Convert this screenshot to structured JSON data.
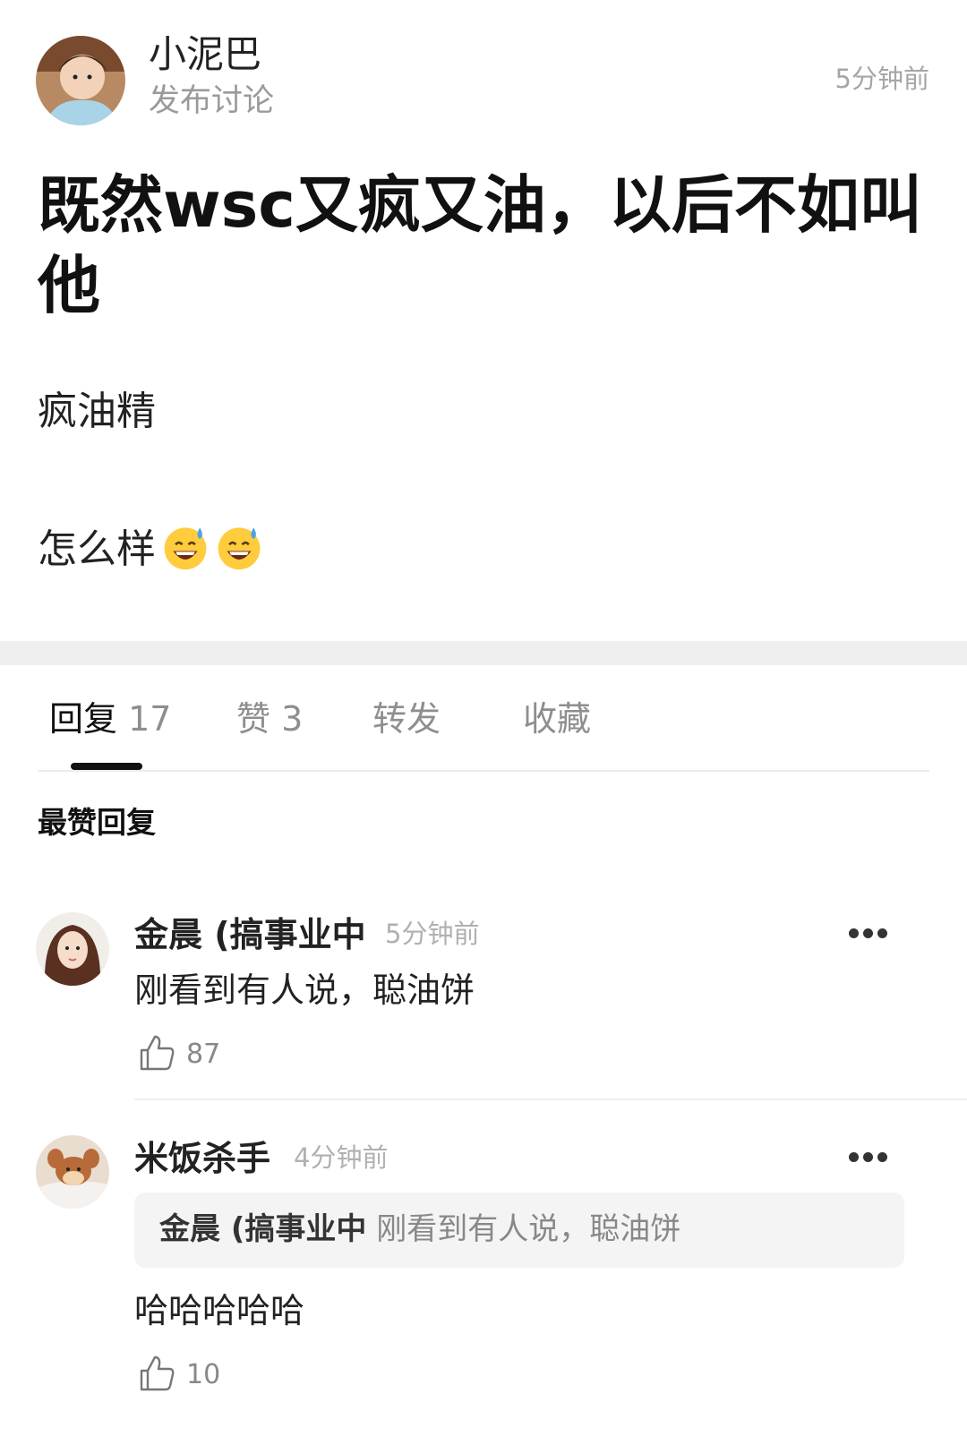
{
  "post": {
    "author": {
      "name": "小泥巴",
      "action": "发布讨论"
    },
    "time": "5分钟前",
    "title": "既然wsc又疯又油，以后不如叫他",
    "body_lines": [
      "疯油精",
      "怎么样"
    ],
    "emojis": [
      "grinning-sweat-emoji",
      "grinning-sweat-emoji"
    ]
  },
  "tabs": [
    {
      "label": "回复",
      "count": "17",
      "active": true
    },
    {
      "label": "赞",
      "count": "3",
      "active": false
    },
    {
      "label": "转发",
      "count": "",
      "active": false
    },
    {
      "label": "收藏",
      "count": "",
      "active": false
    }
  ],
  "section": {
    "label": "最赞回复"
  },
  "comments": [
    {
      "author": "金晨 (搞事业中",
      "time": "5分钟前",
      "text": "刚看到有人说，聪油饼",
      "likes": "87"
    },
    {
      "author": "米饭杀手",
      "time": "4分钟前",
      "quote": {
        "author": "金晨 (搞事业中",
        "text": "刚看到有人说，聪油饼"
      },
      "text": "哈哈哈哈哈",
      "likes": "10"
    }
  ]
}
